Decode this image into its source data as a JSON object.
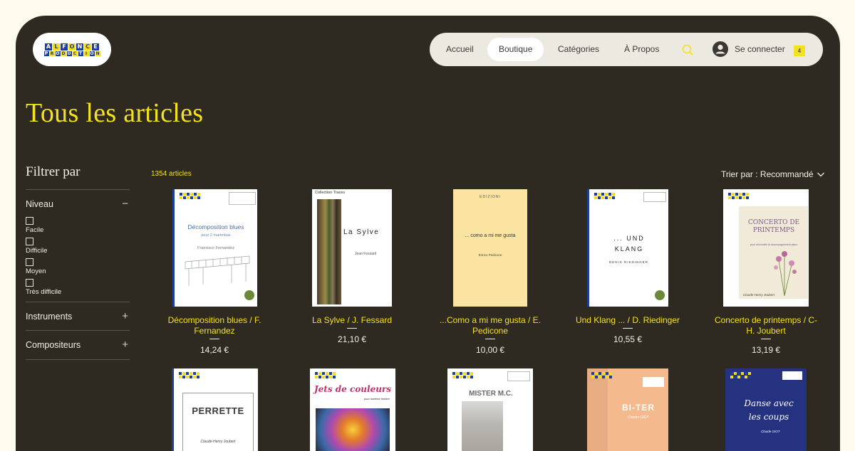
{
  "header": {
    "logo_letters_top": [
      "A",
      "L",
      "F",
      "O",
      "N",
      "C",
      "E"
    ],
    "logo_letters_bottom": [
      "P",
      "R",
      "O",
      "D",
      "U",
      "C",
      "T",
      "I",
      "O",
      "N"
    ],
    "nav": [
      "Accueil",
      "Boutique",
      "Catégories",
      "À Propos"
    ],
    "login": "Se connecter",
    "cart_count": "4"
  },
  "page_title": "Tous les articles",
  "filters": {
    "title": "Filtrer par",
    "sections": [
      {
        "label": "Niveau",
        "expanded": true,
        "sign": "−",
        "options": [
          "Facile",
          "Difficile",
          "Moyen",
          "Très difficile"
        ]
      },
      {
        "label": "Instruments",
        "expanded": false,
        "sign": "+"
      },
      {
        "label": "Compositeurs",
        "expanded": false,
        "sign": "+"
      }
    ]
  },
  "catalog": {
    "count": "1354 articles",
    "sort_label": "Trier par : Recommandé"
  },
  "products": [
    {
      "name": "Décomposition blues / F. Fernandez",
      "price": "14,24 €",
      "cover_title": "Décomposition blues",
      "cover_sub": "pour 2 marimbas",
      "cover_author": "Francisco Fernandez"
    },
    {
      "name": "La Sylve / J. Fessard",
      "price": "21,10 €",
      "cover_title": "La Sylve",
      "cover_sub": "Collection Traces",
      "cover_author": "Jean Fessard"
    },
    {
      "name": "...Como a mi me gusta / E. Pedicone",
      "price": "10,00 €",
      "cover_title": "... como a mi me gusta",
      "cover_sub": "EDIZIONI",
      "cover_author": "Enrico Pedicone"
    },
    {
      "name": "Und Klang ... / D. Riedinger",
      "price": "10,55 €",
      "cover_title": "... UND KLANG",
      "cover_sub": "",
      "cover_author": "DENIS RIEDINGER"
    },
    {
      "name": "Concerto de printemps / C-H. Joubert",
      "price": "13,19 €",
      "cover_title": "CONCERTO DE PRINTEMPS",
      "cover_sub": "pour violoncelle et accompagnement piano",
      "cover_author": "Claude-Henry Joubert"
    }
  ],
  "second_row": [
    {
      "cover_title": "PERRETTE",
      "cover_author": "Claude-Henry Joubert"
    },
    {
      "cover_title": "Jets de couleurs",
      "cover_sub": "pour batterie fanfare"
    },
    {
      "cover_title": "MISTER M.C."
    },
    {
      "cover_title": "BI-TER",
      "cover_author": "Claude GIOT"
    },
    {
      "cover_title": "Danse avec les coups",
      "cover_author": "Claude GIOT"
    }
  ],
  "colors": {
    "background": "#2e2a22",
    "accent": "#f4e21c",
    "page": "#fdfbee",
    "nav_pill": "#ece9e1"
  }
}
